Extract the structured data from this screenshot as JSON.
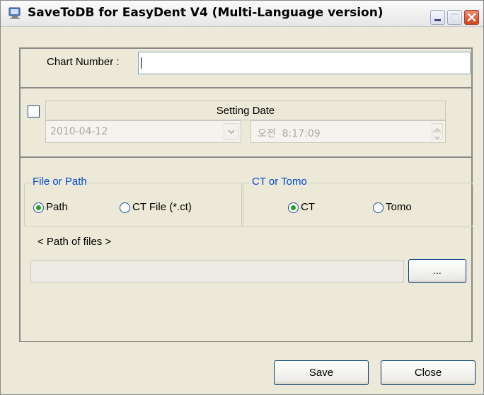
{
  "window": {
    "title": "SaveToDB for EasyDent V4 (Multi-Language version)",
    "icons": [
      "app-icon",
      "minimize-icon",
      "maximize-icon",
      "close-icon"
    ]
  },
  "chart_number": {
    "label": "Chart Number :",
    "value": ""
  },
  "setting_date": {
    "checked": false,
    "header": "Setting Date",
    "date_value": "2010-04-12",
    "time_value": "오전  8:17:09"
  },
  "file_or_path": {
    "group_label": "File or Path",
    "options": [
      {
        "label": "Path",
        "selected": true
      },
      {
        "label": "CT File (*.ct)",
        "selected": false
      }
    ]
  },
  "ct_or_tomo": {
    "group_label": "CT or Tomo",
    "options": [
      {
        "label": "CT",
        "selected": true
      },
      {
        "label": "Tomo",
        "selected": false
      }
    ]
  },
  "path_of_files": {
    "label": "< Path of files >",
    "value": "",
    "browse_label": "..."
  },
  "buttons": {
    "save": "Save",
    "close": "Close"
  },
  "colors": {
    "group_label": "#0046d5",
    "radio_dot": "#21a121",
    "close_button": "#d2451c"
  }
}
